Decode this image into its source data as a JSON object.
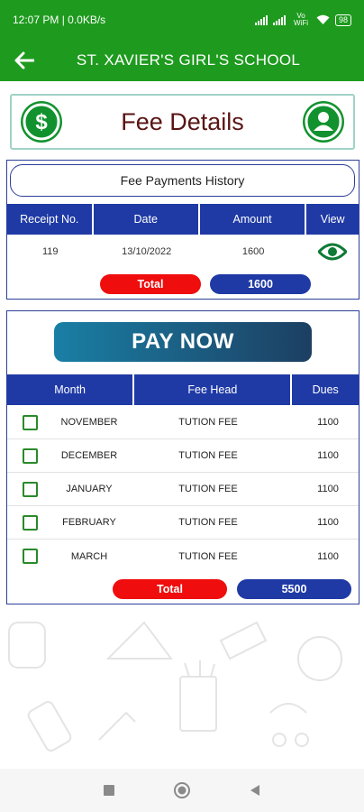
{
  "status_bar": {
    "time_info": "12:07 PM | 0.0KB/s",
    "network": "Vo WiFi",
    "battery": "98"
  },
  "app_bar": {
    "title": "ST. XAVIER'S GIRL'S SCHOOL"
  },
  "header": {
    "title": "Fee Details"
  },
  "history": {
    "title": "Fee Payments History",
    "columns": [
      "Receipt No.",
      "Date",
      "Amount",
      "View"
    ],
    "rows": [
      {
        "receipt_no": "119",
        "date": "13/10/2022",
        "amount": "1600"
      }
    ],
    "total_label": "Total",
    "total_value": "1600"
  },
  "pay": {
    "button_label": "PAY NOW",
    "columns": [
      "Month",
      "Fee Head",
      "Dues"
    ],
    "rows": [
      {
        "month": "NOVEMBER",
        "fee_head": "TUTION FEE",
        "dues": "1100"
      },
      {
        "month": "DECEMBER",
        "fee_head": "TUTION FEE",
        "dues": "1100"
      },
      {
        "month": "JANUARY",
        "fee_head": "TUTION FEE",
        "dues": "1100"
      },
      {
        "month": "FEBRUARY",
        "fee_head": "TUTION FEE",
        "dues": "1100"
      },
      {
        "month": "MARCH",
        "fee_head": "TUTION FEE",
        "dues": "1100"
      }
    ],
    "total_label": "Total",
    "total_value": "5500"
  },
  "colors": {
    "app_green": "#1e9b1e",
    "icon_green": "#12922e",
    "header_blue": "#1f3aa5",
    "total_red": "#ef0d0d"
  }
}
